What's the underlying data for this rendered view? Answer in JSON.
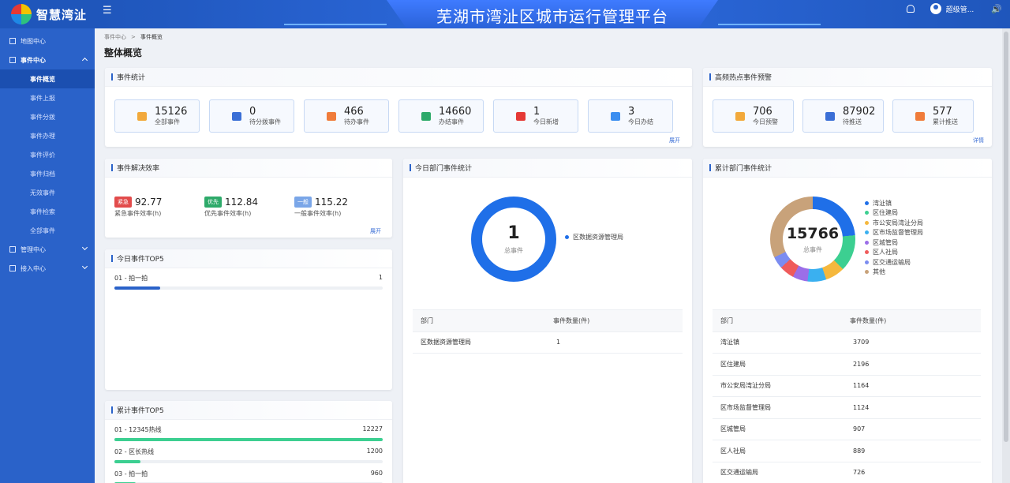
{
  "brand": {
    "name": "智慧湾沚"
  },
  "sidebar": {
    "items": [
      {
        "label": "地图中心"
      },
      {
        "label": "事件中心"
      },
      {
        "label": "管理中心"
      },
      {
        "label": "接入中心"
      }
    ],
    "event_sub": [
      "事件概览",
      "事件上报",
      "事件分拨",
      "事件办理",
      "事件评价",
      "事件归档",
      "无效事件",
      "事件检索",
      "全部事件"
    ]
  },
  "header": {
    "title": "芜湖市湾沚区城市运行管理平台",
    "user": "超级管..."
  },
  "breadcrumb": {
    "root": "事件中心",
    "current": "事件概览"
  },
  "page": {
    "title": "整体概览"
  },
  "event_stats": {
    "title": "事件统计",
    "more": "展开",
    "items": [
      {
        "value": "15126",
        "label": "全部事件",
        "color": "#f2a93b"
      },
      {
        "value": "0",
        "label": "待分拨事件",
        "color": "#3b6fd6"
      },
      {
        "value": "466",
        "label": "待办事件",
        "color": "#f07c3a"
      },
      {
        "value": "14660",
        "label": "办结事件",
        "color": "#2eaa6a"
      },
      {
        "value": "1",
        "label": "今日新增",
        "color": "#e53935"
      },
      {
        "value": "3",
        "label": "今日办结",
        "color": "#3b8ef0"
      }
    ]
  },
  "hotspot": {
    "title": "高频热点事件预警",
    "more": "详情",
    "items": [
      {
        "value": "706",
        "label": "今日预警",
        "color": "#f2a93b"
      },
      {
        "value": "87902",
        "label": "待推送",
        "color": "#3b6fd6"
      },
      {
        "value": "577",
        "label": "累计推送",
        "color": "#f07c3a"
      }
    ]
  },
  "efficiency": {
    "title": "事件解决效率",
    "more": "展开",
    "items": [
      {
        "badge": "紧急",
        "value": "92.77",
        "label": "紧急事件效率(h)",
        "color": "#e24b4b"
      },
      {
        "badge": "优先",
        "value": "112.84",
        "label": "优先事件效率(h)",
        "color": "#2eaa6a"
      },
      {
        "badge": "一般",
        "value": "115.22",
        "label": "一般事件效率(h)",
        "color": "#7aa6e8"
      }
    ]
  },
  "today_top5": {
    "title": "今日事件TOP5",
    "rows": [
      {
        "label": "01 - 拍一拍",
        "count": "1",
        "ratio": 0.17
      }
    ]
  },
  "total_top5": {
    "title": "累计事件TOP5",
    "rows": [
      {
        "label": "01 - 12345热线",
        "count": "12227",
        "ratio": 1.0
      },
      {
        "label": "02 - 区长热线",
        "count": "1200",
        "ratio": 0.098
      },
      {
        "label": "03 - 拍一拍",
        "count": "960",
        "ratio": 0.079
      }
    ]
  },
  "today_dept": {
    "title": "今日部门事件统计",
    "total": "1",
    "total_label": "总事件",
    "legend": [
      {
        "name": "区数据资源管理局",
        "color": "#1f6fe8"
      }
    ],
    "table": {
      "headers": [
        "部门",
        "事件数量(件)"
      ],
      "rows": [
        [
          "区数据资源管理局",
          "1"
        ]
      ]
    }
  },
  "total_dept": {
    "title": "累计部门事件统计",
    "total": "15766",
    "total_label": "总事件",
    "legend": [
      {
        "name": "湾沚镇",
        "color": "#1f6fe8"
      },
      {
        "name": "区住建局",
        "color": "#3ccf91"
      },
      {
        "name": "市公安局湾沚分局",
        "color": "#f5b83d"
      },
      {
        "name": "区市场监督管理局",
        "color": "#3ab0f0"
      },
      {
        "name": "区城管局",
        "color": "#9b6ee8"
      },
      {
        "name": "区人社局",
        "color": "#ef5b5b"
      },
      {
        "name": "区交通运输局",
        "color": "#7b8cf0"
      },
      {
        "name": "其他",
        "color": "#c8a27a"
      }
    ],
    "segments": [
      3709,
      2196,
      1164,
      1124,
      907,
      889,
      726,
      5051
    ],
    "table": {
      "headers": [
        "部门",
        "事件数量(件)"
      ],
      "rows": [
        [
          "湾沚镇",
          "3709"
        ],
        [
          "区住建局",
          "2196"
        ],
        [
          "市公安局湾沚分局",
          "1164"
        ],
        [
          "区市场监督管理局",
          "1124"
        ],
        [
          "区城管局",
          "907"
        ],
        [
          "区人社局",
          "889"
        ],
        [
          "区交通运输局",
          "726"
        ]
      ]
    }
  }
}
